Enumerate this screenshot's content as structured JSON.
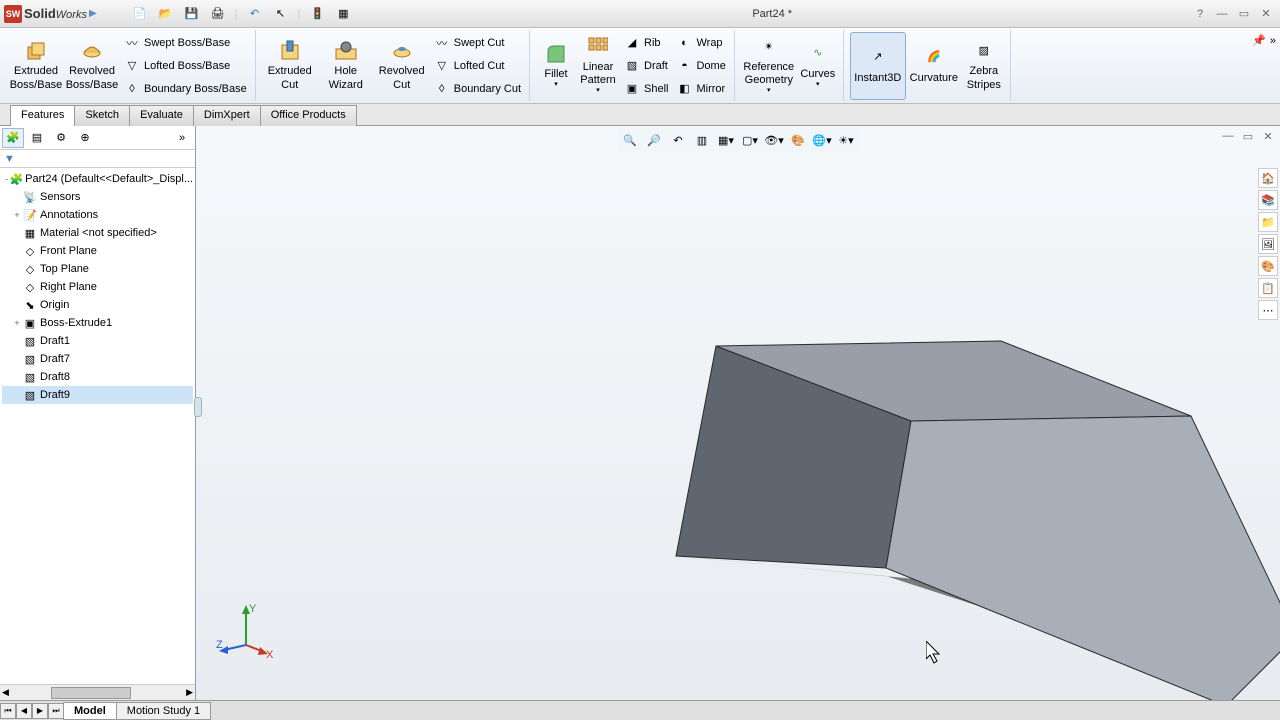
{
  "app": {
    "name": "SolidWorks",
    "title": "Part24 *"
  },
  "qat": {
    "items": [
      "new",
      "open",
      "save",
      "print",
      "undo",
      "select",
      "rebuild",
      "options"
    ]
  },
  "ribbon": {
    "extruded_boss": "Extruded Boss/Base",
    "revolved_boss": "Revolved Boss/Base",
    "swept_boss": "Swept Boss/Base",
    "lofted_boss": "Lofted Boss/Base",
    "boundary_boss": "Boundary Boss/Base",
    "extruded_cut": "Extruded Cut",
    "hole_wizard": "Hole Wizard",
    "revolved_cut": "Revolved Cut",
    "swept_cut": "Swept Cut",
    "lofted_cut": "Lofted Cut",
    "boundary_cut": "Boundary Cut",
    "fillet": "Fillet",
    "linear_pattern": "Linear Pattern",
    "rib": "Rib",
    "draft": "Draft",
    "shell": "Shell",
    "wrap": "Wrap",
    "dome": "Dome",
    "mirror": "Mirror",
    "reference_geometry": "Reference Geometry",
    "curves": "Curves",
    "instant3d": "Instant3D",
    "curvature": "Curvature",
    "zebra": "Zebra Stripes"
  },
  "tabs": [
    "Features",
    "Sketch",
    "Evaluate",
    "DimXpert",
    "Office Products"
  ],
  "tree": {
    "root": "Part24  (Default<<Default>_Displ...",
    "items": [
      {
        "icon": "sensors",
        "label": "Sensors",
        "indent": 1
      },
      {
        "icon": "annotations",
        "label": "Annotations",
        "indent": 1,
        "expand": "+"
      },
      {
        "icon": "material",
        "label": "Material <not specified>",
        "indent": 1
      },
      {
        "icon": "plane",
        "label": "Front Plane",
        "indent": 1
      },
      {
        "icon": "plane",
        "label": "Top Plane",
        "indent": 1
      },
      {
        "icon": "plane",
        "label": "Right Plane",
        "indent": 1
      },
      {
        "icon": "origin",
        "label": "Origin",
        "indent": 1
      },
      {
        "icon": "extrude",
        "label": "Boss-Extrude1",
        "indent": 1,
        "expand": "+"
      },
      {
        "icon": "draft",
        "label": "Draft1",
        "indent": 1
      },
      {
        "icon": "draft",
        "label": "Draft7",
        "indent": 1
      },
      {
        "icon": "draft",
        "label": "Draft8",
        "indent": 1
      },
      {
        "icon": "draft",
        "label": "Draft9",
        "indent": 1,
        "selected": true
      }
    ]
  },
  "triad": {
    "x": "X",
    "y": "Y",
    "z": "Z"
  },
  "bottom_tabs": [
    "Model",
    "Motion Study 1"
  ]
}
